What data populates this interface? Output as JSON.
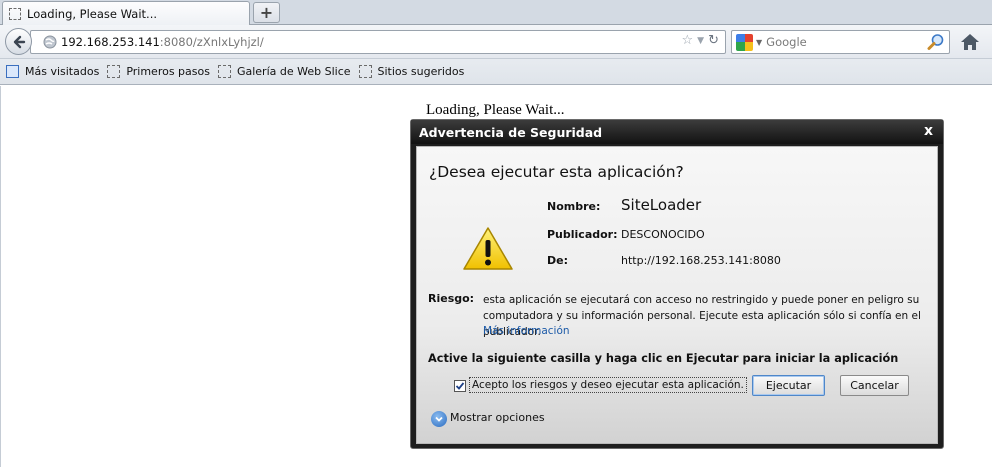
{
  "browser": {
    "tab_title": "Loading, Please Wait...",
    "new_tab_label": "+",
    "url_host": "192.168.253.141",
    "url_rest": ":8080/zXnlxLyhjzl/",
    "search_placeholder": "Google",
    "bookmarks": [
      {
        "label": "Más visitados"
      },
      {
        "label": "Primeros pasos"
      },
      {
        "label": "Galería de Web Slice"
      },
      {
        "label": "Sitios sugeridos"
      }
    ]
  },
  "page": {
    "loading_text": "Loading, Please Wait..."
  },
  "dialog": {
    "title": "Advertencia de Seguridad",
    "close_glyph": "x",
    "question": "¿Desea ejecutar esta aplicación?",
    "fields": {
      "name_label": "Nombre:",
      "name_value": "SiteLoader",
      "publisher_label": "Publicador:",
      "publisher_value": "DESCONOCIDO",
      "from_label": "De:",
      "from_value": "http://192.168.253.141:8080"
    },
    "risk_label": "Riesgo:",
    "risk_text": "esta aplicación se ejecutará con acceso no restringido y puede poner en peligro su computadora y su información personal. Ejecute esta aplicación sólo si confía en el publicador.",
    "more_info": "Más información",
    "instruction": "Active la siguiente casilla y haga clic en Ejecutar para iniciar la aplicación",
    "checkbox_label": "Acepto los riesgos y deseo ejecutar esta aplicación.",
    "checkbox_checked": true,
    "run_button": "Ejecutar",
    "cancel_button": "Cancelar",
    "show_options": "Mostrar opciones"
  },
  "icons": {
    "warning": "warning-triangle-icon",
    "back": "back-arrow-icon",
    "home": "home-icon",
    "search": "magnifier-icon",
    "options": "chevron-down-circle-icon"
  },
  "colors": {
    "dialog_titlebar": "#1e1e1e",
    "link": "#1c5aa8",
    "warning_yellow": "#f5d21a"
  }
}
